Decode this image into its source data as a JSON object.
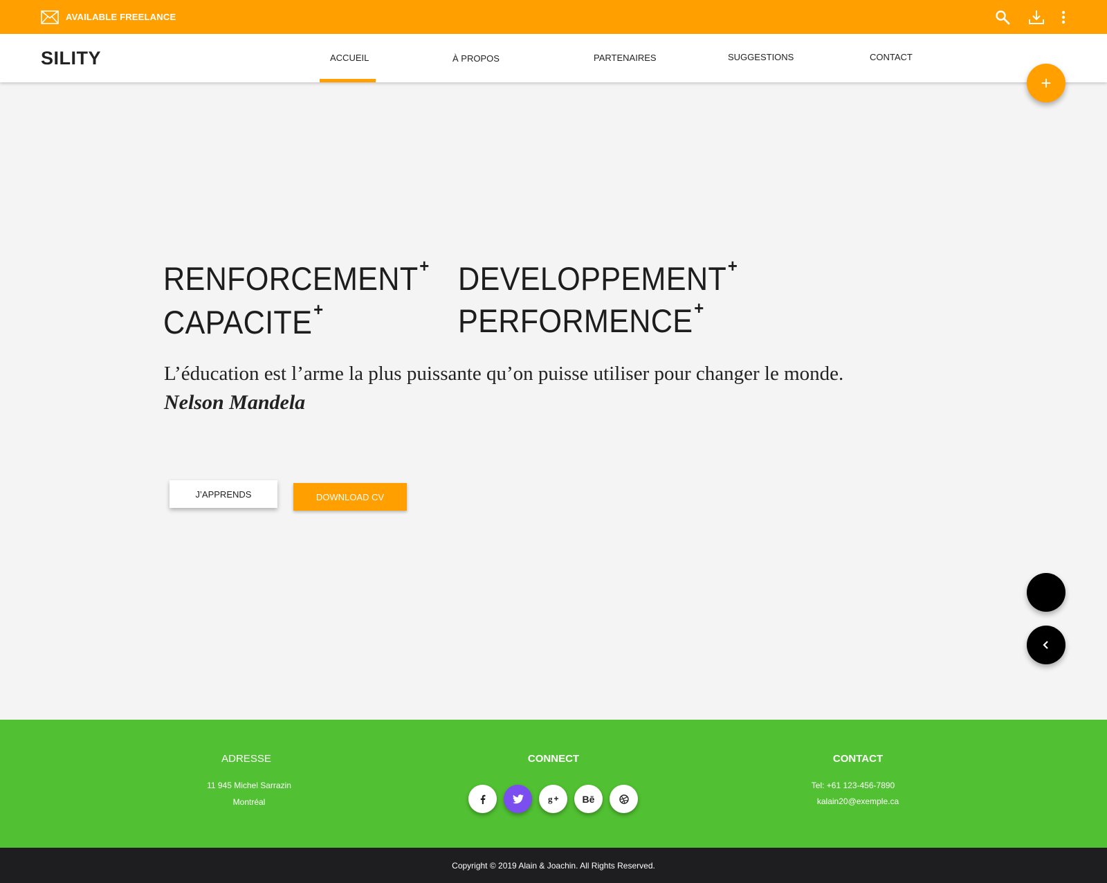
{
  "colors": {
    "accent": "#ff9f00",
    "footer_green": "#51c032",
    "footer_dark": "#1e1e20",
    "twitter_purple": "#7b4ef0"
  },
  "topbar": {
    "freelance_label": "AVAILABLE FREELANCE",
    "icons": [
      "mail-icon",
      "search-icon",
      "download-icon",
      "more-vert-icon"
    ]
  },
  "navbar": {
    "brand": "SILITY",
    "links": [
      "ACCUEIL",
      "À PROPOS",
      "PARTENAIRES",
      "SUGGESTIONS",
      "CONTACT"
    ],
    "active": "ACCUEIL"
  },
  "fab": {
    "plus_icon": "+"
  },
  "hero": {
    "words": [
      "RENFORCEMENT",
      "DEVELOPPEMENT",
      "CAPACITE",
      "PERFORMENCE"
    ],
    "plus_mark": "+",
    "quote": "L’éducation est l’arme la plus puissante qu’on puisse utiliser pour changer le monde.",
    "author": "Nelson Mandela",
    "button_primary": "J’APPRENDS",
    "button_secondary": "DOWNLOAD CV"
  },
  "footer": {
    "address": {
      "title": "ADRESSE",
      "line1": "11 945 Michel Sarrazin",
      "line2": "Montréal"
    },
    "connect": {
      "title": "CONNECT",
      "icons": [
        "facebook-icon",
        "twitter-icon",
        "google-plus-icon",
        "behance-icon",
        "dribbble-icon"
      ],
      "behance_text": "Bē"
    },
    "contact": {
      "title": "CONTACT",
      "phone": "Tel: +61 123-456-7890",
      "email": "kalain20@exemple.ca"
    }
  },
  "copyright": "Copyright © 2019 Alain & Joachin. All Rights Reserved."
}
